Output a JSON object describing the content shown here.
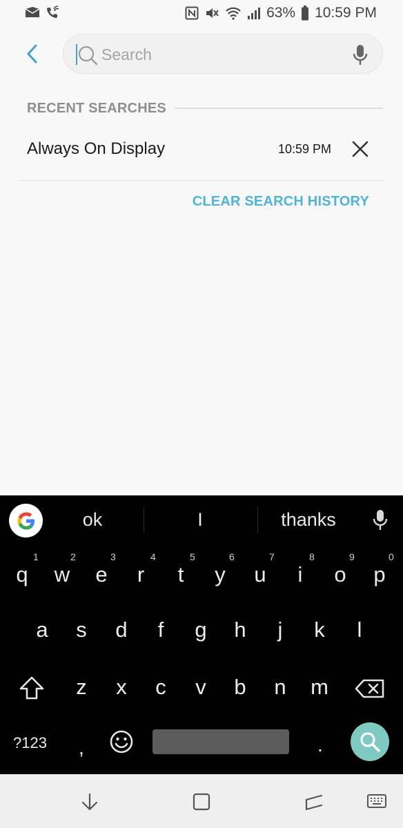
{
  "status_bar": {
    "battery": "63%",
    "time": "10:59 PM",
    "left_icons": [
      "mail-icon",
      "wifi-call-icon"
    ],
    "right_icons": [
      "nfc-icon",
      "vibrate-icon",
      "wifi-icon",
      "signal-icon",
      "battery-icon"
    ]
  },
  "search": {
    "placeholder": "Search",
    "value": "",
    "back_icon": "back-arrow-icon",
    "mic_icon": "mic-icon"
  },
  "recent": {
    "title": "RECENT SEARCHES",
    "items": [
      {
        "text": "Always On Display",
        "time": "10:59 PM"
      }
    ],
    "clear_label": "CLEAR SEARCH HISTORY"
  },
  "keyboard": {
    "suggestions": [
      "ok",
      "I",
      "thanks"
    ],
    "row1": [
      {
        "k": "q",
        "h": "1"
      },
      {
        "k": "w",
        "h": "2"
      },
      {
        "k": "e",
        "h": "3"
      },
      {
        "k": "r",
        "h": "4"
      },
      {
        "k": "t",
        "h": "5"
      },
      {
        "k": "y",
        "h": "6"
      },
      {
        "k": "u",
        "h": "7"
      },
      {
        "k": "i",
        "h": "8"
      },
      {
        "k": "o",
        "h": "9"
      },
      {
        "k": "p",
        "h": "0"
      }
    ],
    "row2": [
      "a",
      "s",
      "d",
      "f",
      "g",
      "h",
      "j",
      "k",
      "l"
    ],
    "row3": [
      "z",
      "x",
      "c",
      "v",
      "b",
      "n",
      "m"
    ],
    "sym_label": "?123",
    "comma": ",",
    "period": ".",
    "accent": "#7ecac2"
  },
  "colors": {
    "accent": "#4fb4d6",
    "keyboard_bg": "#000000",
    "background": "#f8f8f8"
  }
}
